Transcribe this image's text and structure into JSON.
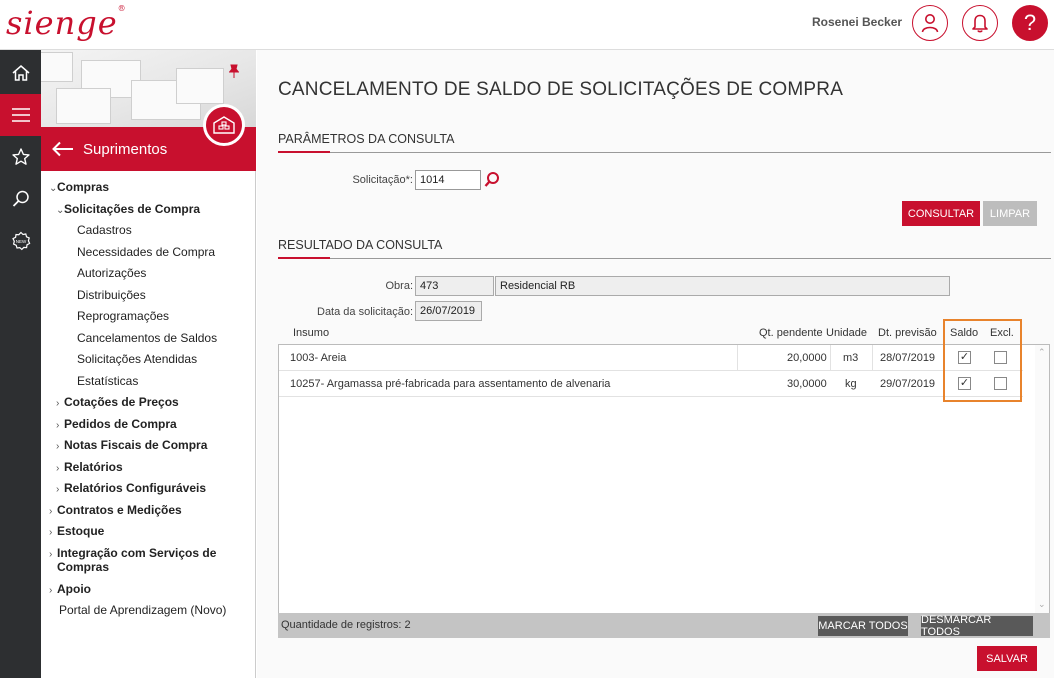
{
  "topbar": {
    "logo": "sienge",
    "user_name": "Rosenei Becker",
    "help_label": "?"
  },
  "sidebar": {
    "module_title": "Suprimentos",
    "menu": [
      {
        "label": "Compras",
        "bold": true,
        "caret": "v"
      },
      {
        "label": "Solicitações de Compra",
        "bold": true,
        "caret": "v"
      },
      {
        "label": "Cadastros"
      },
      {
        "label": "Necessidades de Compra"
      },
      {
        "label": "Autorizações"
      },
      {
        "label": "Distribuições"
      },
      {
        "label": "Reprogramações"
      },
      {
        "label": "Cancelamentos de Saldos"
      },
      {
        "label": "Solicitações Atendidas"
      },
      {
        "label": "Estatísticas"
      },
      {
        "label": "Cotações de Preços",
        "bold": true,
        "caret": ">"
      },
      {
        "label": "Pedidos de Compra",
        "bold": true,
        "caret": ">"
      },
      {
        "label": "Notas Fiscais de Compra",
        "bold": true,
        "caret": ">"
      },
      {
        "label": "Relatórios",
        "bold": true,
        "caret": ">"
      },
      {
        "label": "Relatórios Configuráveis",
        "bold": true,
        "caret": ">"
      },
      {
        "label": "Contratos e Medições",
        "bold": true,
        "caret": ">"
      },
      {
        "label": "Estoque",
        "bold": true,
        "caret": ">"
      },
      {
        "label": "Integração com Serviços de",
        "label2": "Compras",
        "bold": true,
        "caret": ">"
      },
      {
        "label": "Apoio",
        "bold": true,
        "caret": ">"
      },
      {
        "label": "Portal de Aprendizagem (Novo)"
      }
    ]
  },
  "main": {
    "page_title": "CANCELAMENTO DE SALDO DE SOLICITAÇÕES DE COMPRA",
    "params_title": "PARÂMETROS DA CONSULTA",
    "solicitacao_label": "Solicitação*:",
    "solicitacao_value": "1014",
    "consultar_label": "CONSULTAR",
    "limpar_label": "LIMPAR",
    "result_title": "RESULTADO DA CONSULTA",
    "obra_label": "Obra:",
    "obra_code": "473",
    "obra_name": "Residencial RB",
    "data_label": "Data da solicitação:",
    "data_value": "26/07/2019",
    "columns": {
      "insumo": "Insumo",
      "qt_pendente": "Qt. pendente",
      "unidade": "Unidade",
      "dt_previsao": "Dt. previsão",
      "saldo": "Saldo",
      "excl": "Excl."
    },
    "rows": [
      {
        "insumo": "1003- Areia",
        "qt": "20,0000",
        "un": "m3",
        "dt": "28/07/2019",
        "saldo": "✓",
        "excl": ""
      },
      {
        "insumo": "10257- Argamassa pré-fabricada para assentamento de alvenaria",
        "qt": "30,0000",
        "un": "kg",
        "dt": "29/07/2019",
        "saldo": "✓",
        "excl": ""
      }
    ],
    "record_count": "Quantidade de registros: 2",
    "marcar_todos": "MARCAR TODOS",
    "desmarcar_todos": "DESMARCAR TODOS",
    "salvar": "SALVAR"
  },
  "colors": {
    "brand": "#c8102e",
    "rail": "#2d2f31",
    "highlight": "#e8832c"
  }
}
